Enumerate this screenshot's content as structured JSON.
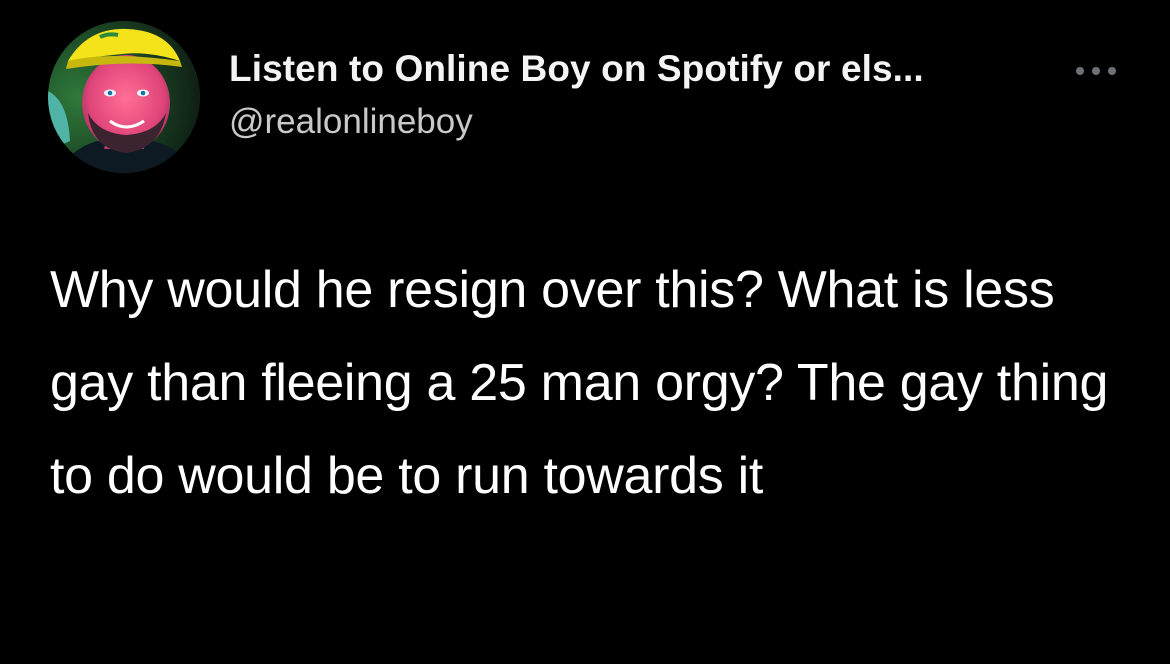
{
  "author": {
    "display_name": "Listen to Online Boy on Spotify or els...",
    "handle": "@realonlineboy"
  },
  "tweet": {
    "text": "Why would he resign over this? What is less gay than fleeing a 25 man orgy? The gay thing to do would be to run towards it"
  },
  "icons": {
    "more": "more-horizontal-icon",
    "avatar": "profile-avatar"
  },
  "colors": {
    "background": "#000000",
    "text_primary": "#ffffff",
    "text_secondary": "#c9c9c9",
    "icon_muted": "#6e7175"
  }
}
